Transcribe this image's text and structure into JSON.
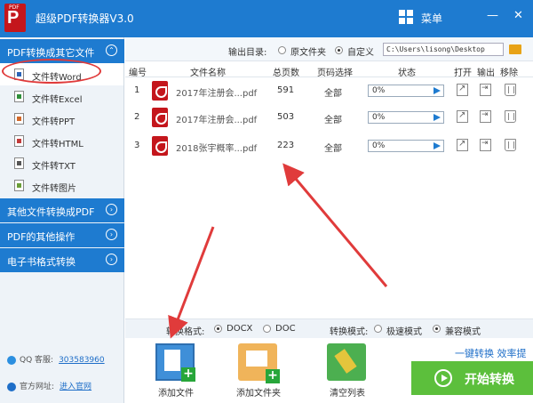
{
  "app": {
    "title": "超级PDF转换器V3.0",
    "logo_text": "PDF",
    "menu_label": "菜单"
  },
  "window_controls": {
    "minimize": "—",
    "close": "✕"
  },
  "sidebar": {
    "sections": [
      {
        "label": "PDF转换成其它文件",
        "expanded": true
      },
      {
        "label": "其他文件转换成PDF",
        "expanded": false
      },
      {
        "label": "PDF的其他操作",
        "expanded": false
      },
      {
        "label": "电子书格式转换",
        "expanded": false
      }
    ],
    "items": [
      {
        "label": "文件转Word",
        "icon": "word-icon",
        "active": true
      },
      {
        "label": "文件转Excel",
        "icon": "excel-icon"
      },
      {
        "label": "文件转PPT",
        "icon": "ppt-icon"
      },
      {
        "label": "文件转HTML",
        "icon": "html-icon"
      },
      {
        "label": "文件转TXT",
        "icon": "txt-icon"
      },
      {
        "label": "文件转图片",
        "icon": "image-icon"
      }
    ],
    "contact": {
      "qq_label": "QQ 客服:",
      "qq_value": "303583960",
      "site_label": "官方网址:",
      "site_value": "进入官网"
    }
  },
  "output": {
    "label": "输出目录:",
    "option_original": "原文件夹",
    "option_custom": "自定义",
    "selected": "自定义",
    "path": "C:\\Users\\lisong\\Desktop"
  },
  "table": {
    "headers": [
      "编号",
      "文件名称",
      "总页数",
      "页码选择",
      "状态",
      "打开",
      "输出",
      "移除"
    ],
    "rows": [
      {
        "num": "1",
        "name": "2017年注册会...pdf",
        "pages": "591",
        "range": "全部",
        "progress": "0%"
      },
      {
        "num": "2",
        "name": "2017年注册会...pdf",
        "pages": "503",
        "range": "全部",
        "progress": "0%"
      },
      {
        "num": "3",
        "name": "2018张宇概率...pdf",
        "pages": "223",
        "range": "全部",
        "progress": "0%"
      }
    ]
  },
  "options": {
    "format_label": "转换格式:",
    "format_docx": "DOCX",
    "format_doc": "DOC",
    "format_selected": "DOCX",
    "mode_label": "转换模式:",
    "mode_fast": "极速模式",
    "mode_compat": "兼容模式",
    "mode_selected": "兼容模式"
  },
  "actions": {
    "add_file": "添加文件",
    "add_folder": "添加文件夹",
    "clear_list": "清空列表",
    "quick_text": "一键转换 效率提",
    "start": "开始转换"
  },
  "colors": {
    "brand_blue": "#1e7bd0",
    "start_green": "#5cbf3c",
    "annotation_red": "#e03b3b"
  }
}
